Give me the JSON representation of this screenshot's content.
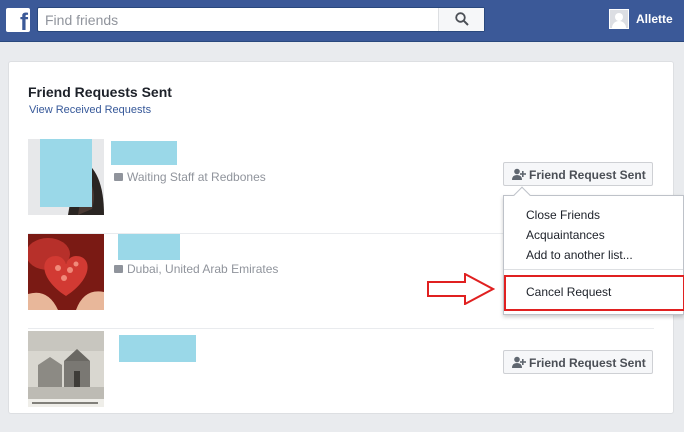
{
  "header": {
    "logo_letter": "f",
    "search_placeholder": "Find friends",
    "user_name": "Allette"
  },
  "page": {
    "title": "Friend Requests Sent",
    "view_received_link": "View Received Requests"
  },
  "requests": [
    {
      "detail": "Waiting Staff at Redbones",
      "button_label": "Friend Request Sent"
    },
    {
      "detail": "Dubai, United Arab Emirates"
    },
    {
      "button_label": "Friend Request Sent"
    }
  ],
  "dropdown": {
    "items": [
      "Close Friends",
      "Acquaintances",
      "Add to another list..."
    ],
    "cancel_label": "Cancel Request"
  },
  "colors": {
    "header_blue": "#3b5998",
    "redacted_name": "#9ad8e8",
    "highlight_red": "#e02020"
  }
}
